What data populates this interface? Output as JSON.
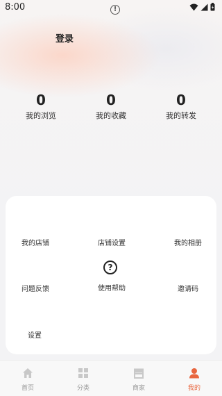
{
  "status_bar": {
    "time": "8:00",
    "alert": "!"
  },
  "header": {
    "login": "登录"
  },
  "stats": [
    {
      "value": "0",
      "label": "我的浏览"
    },
    {
      "value": "0",
      "label": "我的收藏"
    },
    {
      "value": "0",
      "label": "我的转发"
    }
  ],
  "menu": {
    "my_shop": "我的店铺",
    "shop_settings": "店铺设置",
    "my_album": "我的相册",
    "feedback": "问题反馈",
    "help": "使用帮助",
    "help_icon": "?",
    "invite_code": "邀请码",
    "settings": "设置"
  },
  "tabbar": {
    "items": [
      {
        "label": "首页",
        "icon": "home-icon"
      },
      {
        "label": "分类",
        "icon": "grid-icon"
      },
      {
        "label": "商家",
        "icon": "store-icon"
      },
      {
        "label": "我的",
        "icon": "person-icon"
      }
    ],
    "active_index": 3,
    "active_color": "#e8663f",
    "inactive_color": "#c8c8c8"
  }
}
